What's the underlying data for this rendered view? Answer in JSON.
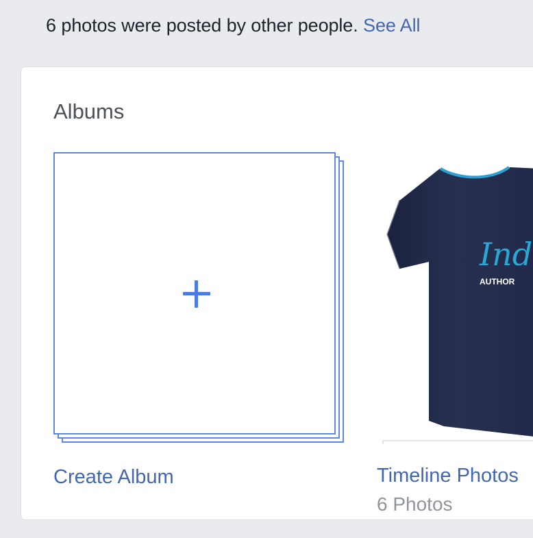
{
  "notice": {
    "text": "6 photos were posted by other people. ",
    "link": "See All"
  },
  "albums": {
    "title": "Albums",
    "create": {
      "label": "Create Album",
      "icon": "plus-icon"
    },
    "items": [
      {
        "title": "Timeline Photos",
        "count": "6 Photos",
        "cover": {
          "shirt_color": "#232c4a",
          "print_script": "Indie",
          "print_caption": "AUTHOR"
        }
      }
    ]
  },
  "colors": {
    "link": "#4267b2",
    "accent_border": "#5b88e8",
    "page_bg": "#e9ebee",
    "muted_text": "#90949c"
  }
}
